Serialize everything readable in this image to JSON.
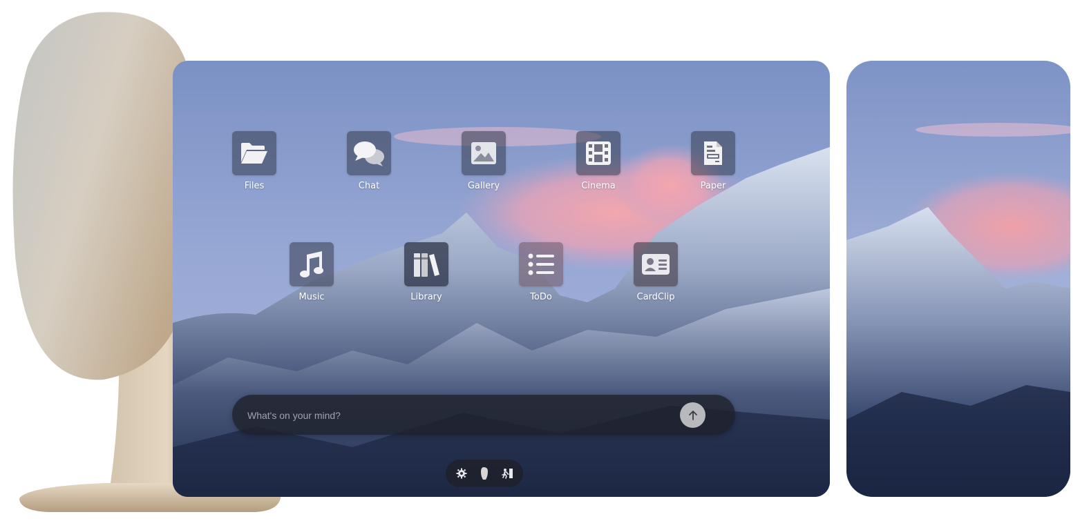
{
  "apps_row1": [
    {
      "label": "Files",
      "icon": "folder-icon"
    },
    {
      "label": "Chat",
      "icon": "chat-bubbles-icon"
    },
    {
      "label": "Gallery",
      "icon": "image-icon"
    },
    {
      "label": "Cinema",
      "icon": "film-icon"
    },
    {
      "label": "Paper",
      "icon": "document-icon"
    }
  ],
  "apps_row2": [
    {
      "label": "Music",
      "icon": "music-note-icon"
    },
    {
      "label": "Library",
      "icon": "books-icon"
    },
    {
      "label": "ToDo",
      "icon": "list-icon"
    },
    {
      "label": "CardClip",
      "icon": "contact-card-icon"
    }
  ],
  "prompt": {
    "placeholder": "What's on your mind?",
    "send_icon": "arrow-up-icon"
  },
  "dock": {
    "icons": [
      "gear-icon",
      "head-icon",
      "exit-icon"
    ]
  },
  "colors": {
    "tile": "#373c4e",
    "bar": "#1e212a",
    "send": "#b8b9bd",
    "sky_top": "#7e94c6",
    "cloud": "#f0a8b4",
    "snow": "#d8e0ee"
  }
}
